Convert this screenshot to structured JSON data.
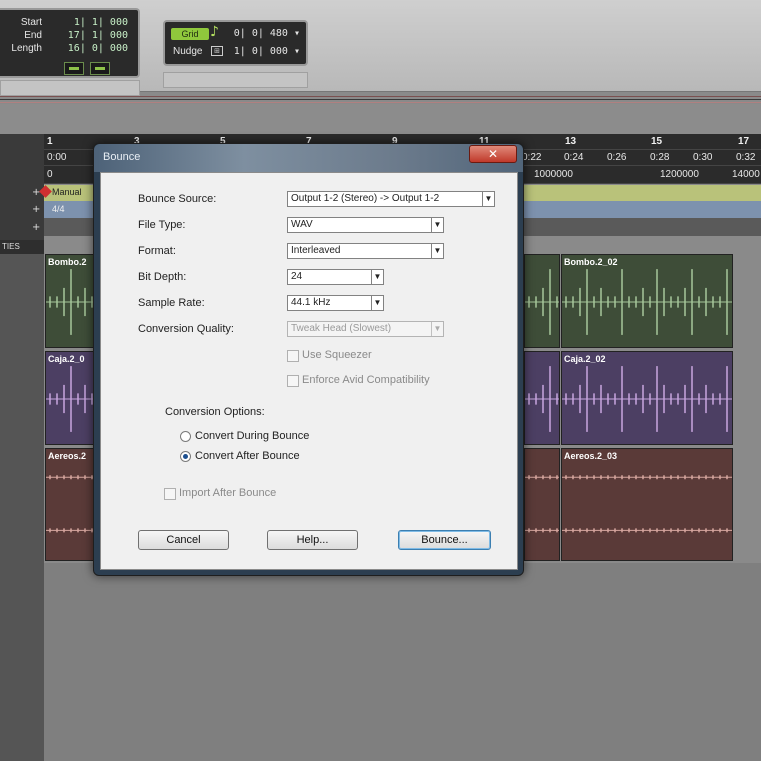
{
  "toolbar": {
    "counter": {
      "rows": [
        {
          "label": "Start",
          "value": "1| 1| 000"
        },
        {
          "label": "End",
          "value": "17| 1| 000"
        },
        {
          "label": "Length",
          "value": "16| 0| 000"
        }
      ]
    },
    "grid": {
      "label": "Grid",
      "value": "0| 0| 480 ▾"
    },
    "nudge": {
      "label": "Nudge",
      "value": "1| 0| 000 ▾"
    }
  },
  "timeline": {
    "bars": [
      "1",
      "3",
      "5",
      "7",
      "9",
      "11",
      "13",
      "15",
      "17"
    ],
    "times": [
      "0:00",
      "0:22",
      "0:24",
      "0:26",
      "0:28",
      "0:30",
      "0:32"
    ],
    "samples": [
      "0",
      "1000000",
      "1200000",
      "14000"
    ],
    "marker_label": "Manual",
    "meter_label": "4/4",
    "left_label": "TIES"
  },
  "tracks": [
    {
      "left_clip": "Bombo.2",
      "right_clip": "Bombo.2_02",
      "color": "#3e4d38",
      "wave": "#a6c79a"
    },
    {
      "left_clip": "Caja.2_0",
      "right_clip": "Caja.2_02",
      "color": "#4c3f63",
      "wave": "#c8a6e0"
    },
    {
      "left_clip": "Aereos.2",
      "right_clip": "Aereos.2_03",
      "color": "#5a3a38",
      "wave": "#d8a8a0"
    }
  ],
  "dialog": {
    "title": "Bounce",
    "close_label": "✕",
    "fields": {
      "bounce_source": {
        "label": "Bounce Source:",
        "value": "Output 1-2 (Stereo) -> Output 1-2"
      },
      "file_type": {
        "label": "File Type:",
        "value": "WAV"
      },
      "format": {
        "label": "Format:",
        "value": "Interleaved"
      },
      "bit_depth": {
        "label": "Bit Depth:",
        "value": "24"
      },
      "sample_rate": {
        "label": "Sample Rate:",
        "value": "44.1 kHz"
      },
      "conversion_quality": {
        "label": "Conversion Quality:",
        "value": "Tweak Head (Slowest)"
      }
    },
    "use_squeezer": "Use Squeezer",
    "enforce_avid": "Enforce Avid Compatibility",
    "conversion_options": {
      "label": "Conversion Options:",
      "during": "Convert During Bounce",
      "after": "Convert After Bounce",
      "selected": "after"
    },
    "import_after": "Import After Bounce",
    "buttons": {
      "cancel": "Cancel",
      "help": "Help...",
      "bounce": "Bounce..."
    }
  }
}
